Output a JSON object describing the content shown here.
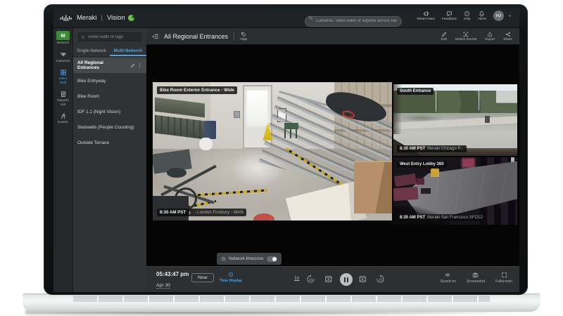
{
  "topbar": {
    "brand_cisco": "cisco",
    "brand_name": "Meraki",
    "brand_product": "Vision",
    "search_placeholder": "Cameras, video walls or exports across networks",
    "actions": [
      {
        "label": "What's New",
        "icon": "megaphone-icon"
      },
      {
        "label": "Feedback",
        "icon": "feedback-icon"
      },
      {
        "label": "Help",
        "icon": "help-icon"
      },
      {
        "label": "Alerts",
        "icon": "bell-icon"
      }
    ],
    "avatar_initials": "HJ"
  },
  "nav_rail": {
    "items": [
      {
        "label": "Network",
        "badge": "M"
      },
      {
        "label": "Cameras",
        "icon": "camera-dome-icon"
      },
      {
        "label": "Video Wall",
        "icon": "video-wall-grid-icon",
        "active": true
      },
      {
        "label": "Exports List",
        "icon": "exports-document-icon"
      },
      {
        "label": "Events",
        "icon": "events-runner-icon"
      }
    ]
  },
  "sidebar": {
    "search_placeholder": "Video walls or tags",
    "tabs": [
      {
        "label": "Single-Network",
        "active": false
      },
      {
        "label": "Multi-Network",
        "active": true
      }
    ],
    "items": [
      {
        "label": "All Regional Entrances",
        "selected": true
      },
      {
        "label": "Bike Entryway",
        "selected": false
      },
      {
        "label": "Bike Room",
        "selected": false
      },
      {
        "label": "IDF 1.1 (Night Vision)",
        "selected": false
      },
      {
        "label": "Stairwells (People Counting)",
        "selected": false
      },
      {
        "label": "Outside Terrace",
        "selected": false
      }
    ]
  },
  "toolbar": {
    "title": "All Regional Entrances",
    "tags_label": "Tags",
    "actions": [
      {
        "label": "Edit",
        "icon": "pencil-icon"
      },
      {
        "label": "Motion Events",
        "icon": "motion-events-icon"
      },
      {
        "label": "Export",
        "icon": "export-icon"
      },
      {
        "label": "Share",
        "icon": "share-icon"
      }
    ]
  },
  "tiles": [
    {
      "name": "Bike Room Exterior Entrance - Wide",
      "time": "8:30 AM PST",
      "location": "- London Finsbury - WAN"
    },
    {
      "name": "South Entrance",
      "time": "8:30 AM PST",
      "location": "Meraki Chicago P..."
    },
    {
      "name": "West Entry Lobby 360",
      "time": "8:30 AM PST",
      "location": "Meraki San Francisco SFO12"
    }
  ],
  "timeline": {
    "timezone_label": "Network timezone",
    "clock": "05:43:47 pm",
    "date": "Apr 30",
    "now_label": "Now",
    "time_display_label": "Time Display",
    "speed": "1x",
    "right_actions": [
      {
        "label": "Sound on",
        "icon": "speaker-icon"
      },
      {
        "label": "Screenshot",
        "icon": "screenshot-camera-icon"
      },
      {
        "label": "Fullscreen",
        "icon": "fullscreen-icon"
      }
    ]
  },
  "colors": {
    "accent_blue": "#4aa3e8",
    "network_badge_green": "#3f8a3a",
    "topbar_bg": "#1f2325",
    "sidebar_bg": "#2f3336",
    "caution_yellow": "#e3c62a"
  }
}
